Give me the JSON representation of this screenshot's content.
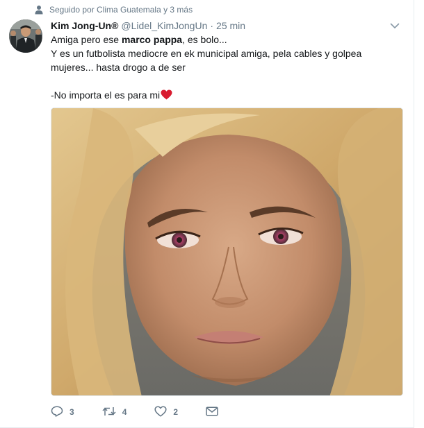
{
  "context": {
    "text": "Seguido por Clima Guatemala y 3 más",
    "icon": "person-icon"
  },
  "tweet": {
    "display_name": "Kim Jong-Un®",
    "handle": "@Lidel_KimJongUn",
    "separator": "·",
    "time": "25 min",
    "text_line1_before": "Amiga pero ese ",
    "text_line1_bold": "marco pappa",
    "text_line1_after": ", es bolo...",
    "text_line2": "Y es un futbolista mediocre en ek municipal amiga, pela cables y golpea mujeres... hasta drogo a de ser",
    "text_line3": "-No importa el es para mi",
    "emoji": "red-heart-icon",
    "heart_color": "#e0245e"
  },
  "actions": {
    "reply_count": "3",
    "retweet_count": "4",
    "like_count": "2"
  },
  "colors": {
    "secondary_text": "#657786",
    "primary_text": "#14171a",
    "border": "#e6ecf0"
  }
}
